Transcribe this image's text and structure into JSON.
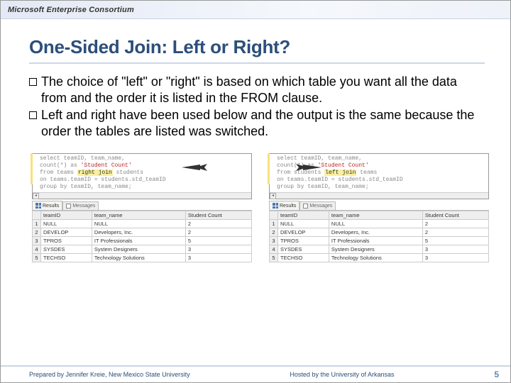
{
  "topbar": {
    "title": "Microsoft Enterprise Consortium"
  },
  "heading": "One-Sided Join: Left or Right?",
  "bullets": [
    "The choice of \"left\" or \"right\" is based on which table you want all the data from and the order it is listed in the FROM clause.",
    "Left and right have been used below and the output is the same because the order the tables are listed was switched."
  ],
  "code": {
    "left": {
      "line1": "select  teamID, team_name,",
      "line2_pre": "count(*) as ",
      "line2_str": "'Student Count'",
      "line3_pre": "from  teams ",
      "line3_hl": "right join",
      "line3_post": " students",
      "line4": "on  teams.teamID = students.std_teamID",
      "line5": "group by  teamID, team_name;"
    },
    "right": {
      "line1": "select  teamID, team_name,",
      "line2_pre": "count(*) as ",
      "line2_str": "'Student Count'",
      "line3_pre": "from  students ",
      "line3_hl": "left join",
      "line3_post": " teams",
      "line4": "on  teams.teamID = students.std_teamID",
      "line5": "group by  teamID, team_name;"
    }
  },
  "tabs": {
    "results": "Results",
    "messages": "Messages"
  },
  "table": {
    "headers": [
      "",
      "teamID",
      "team_name",
      "Student Count"
    ],
    "rows": [
      [
        "1",
        "NULL",
        "NULL",
        "2"
      ],
      [
        "2",
        "DEVELOP",
        "Developers, Inc.",
        "2"
      ],
      [
        "3",
        "TPROS",
        "IT Professionals",
        "5"
      ],
      [
        "4",
        "SYSDES",
        "System Designers",
        "3"
      ],
      [
        "5",
        "TECHSO",
        "Technology Solutions",
        "3"
      ]
    ]
  },
  "footer": {
    "left": "Prepared by Jennifer Kreie, New Mexico State University",
    "right": "Hosted by the University of Arkansas",
    "page": "5"
  }
}
